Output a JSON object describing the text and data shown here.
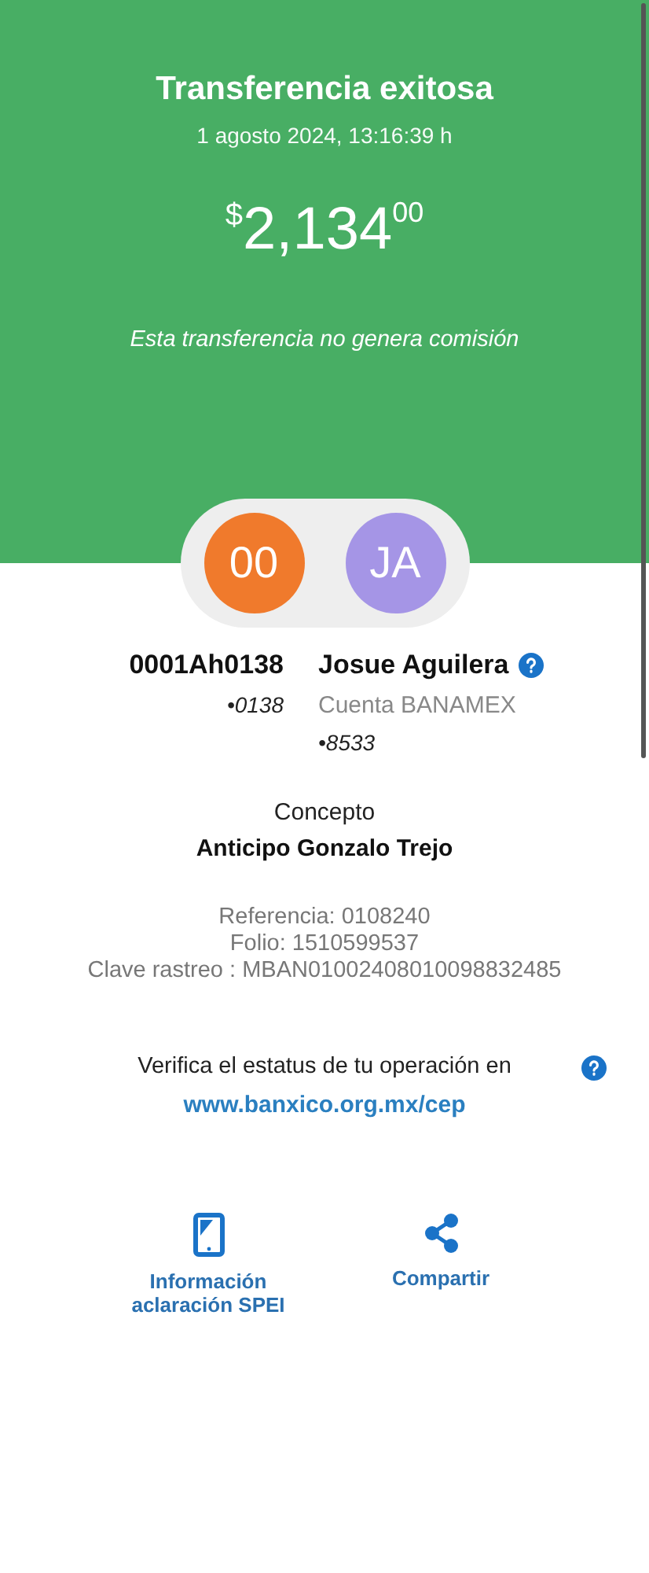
{
  "header": {
    "title": "Transferencia exitosa",
    "datetime": "1 agosto 2024, 13:16:39 h",
    "amount": {
      "currency": "$",
      "whole": "2,134",
      "cents": "00"
    },
    "note": "Esta transferencia no genera comisión"
  },
  "parties": [
    {
      "initials": "00",
      "color": "#f07a2c",
      "name": "0001Ah0138",
      "account": "•0138",
      "help": false
    },
    {
      "initials": "JA",
      "color": "#a595e6",
      "name": "Josue Aguilera",
      "bank": "Cuenta BANAMEX",
      "account": "•8533",
      "help": true
    }
  ],
  "concept": {
    "label": "Concepto",
    "value": "Anticipo Gonzalo Trejo"
  },
  "details": [
    "Referencia: 0108240",
    "Folio: 1510599537",
    "Clave rastreo : MBAN01002408010098832485"
  ],
  "verify": {
    "text": "Verifica el estatus de tu operación en",
    "link": "www.banxico.org.mx/cep"
  },
  "actions": [
    {
      "kind": "phone",
      "label": "Información aclaración SPEI"
    },
    {
      "kind": "share",
      "label": "Compartir"
    }
  ]
}
